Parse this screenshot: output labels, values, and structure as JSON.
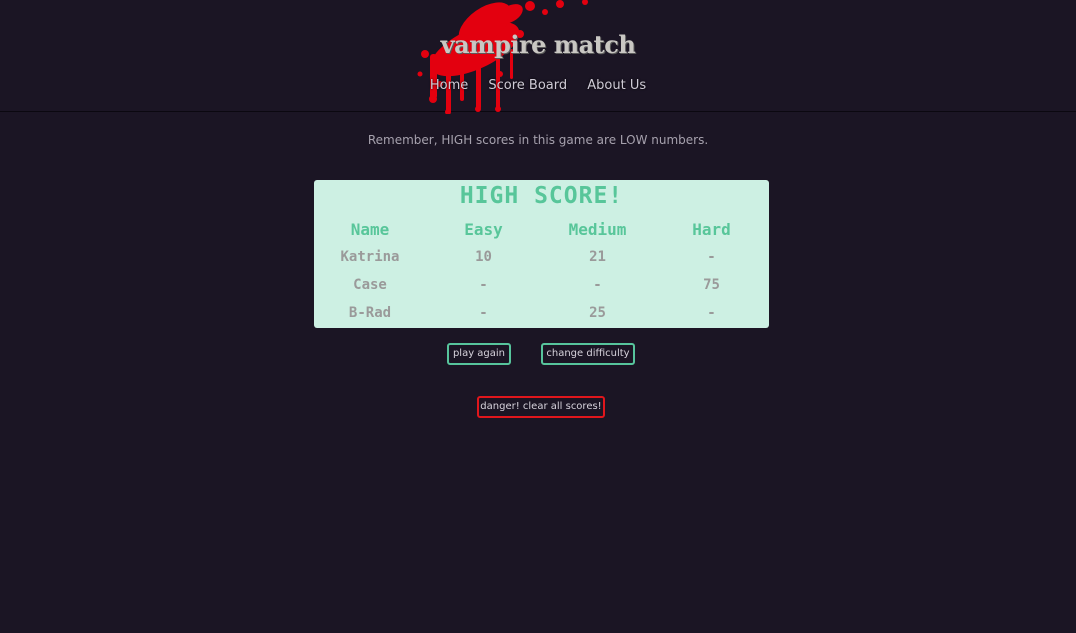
{
  "app": {
    "title": "vampire match"
  },
  "nav": {
    "items": [
      {
        "label": "Home"
      },
      {
        "label": "Score Board"
      },
      {
        "label": "About Us"
      }
    ]
  },
  "reminder": "Remember, HIGH scores in this game are LOW numbers.",
  "scoreboard": {
    "title": "HIGH SCORE!",
    "columns": [
      "Name",
      "Easy",
      "Medium",
      "Hard"
    ],
    "rows": [
      [
        "Katrina",
        "10",
        "21",
        "-"
      ],
      [
        "Case",
        "-",
        "-",
        "75"
      ],
      [
        "B-Rad",
        "-",
        "25",
        "-"
      ]
    ]
  },
  "buttons": {
    "play_again": "play again",
    "change_difficulty": "change difficulty",
    "clear_scores": "danger! clear all scores!"
  },
  "colors": {
    "background": "#1b1524",
    "accent_green": "#57c49c",
    "danger_red": "#e0161c",
    "card_bg": "#cdf0e3",
    "blood": "#e3000f"
  },
  "icons": {
    "logo": "blood-splatter-icon"
  }
}
